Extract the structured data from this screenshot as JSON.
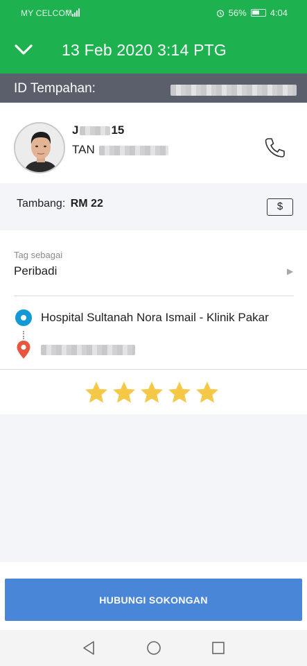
{
  "status_bar": {
    "carrier": "MY CELCOM",
    "network_type": "4G",
    "battery_percent": "56%",
    "time": "4:04"
  },
  "header": {
    "title": "13 Feb 2020 3:14 PTG"
  },
  "booking": {
    "id_label": "ID Tempahan:"
  },
  "driver": {
    "name_prefix": "J",
    "name_suffix": "15",
    "surname": "TAN"
  },
  "fare": {
    "label": "Tambang:",
    "amount": "RM 22",
    "payment_symbol": "$"
  },
  "tag": {
    "label": "Tag sebagai",
    "value": "Peribadi"
  },
  "route": {
    "pickup": "Hospital Sultanah Nora Ismail - Klinik Pakar"
  },
  "rating": {
    "stars_filled": 5,
    "stars_total": 5
  },
  "actions": {
    "support_label": "HUBUNGI SOKONGAN"
  },
  "colors": {
    "brand_green": "#1db24f",
    "id_bar": "#5a5f6b",
    "pickup_blue": "#139ad6",
    "dropoff_red": "#e8563f",
    "star_gold": "#f5c848",
    "button_blue": "#4a86d8"
  },
  "icons": {
    "back": "chevron-down-icon",
    "phone": "phone-icon",
    "payment": "cash-icon",
    "tag_arrow": "chevron-right-icon",
    "pickup": "pickup-dot-icon",
    "dropoff": "location-pin-icon",
    "rating": "star-icon"
  }
}
